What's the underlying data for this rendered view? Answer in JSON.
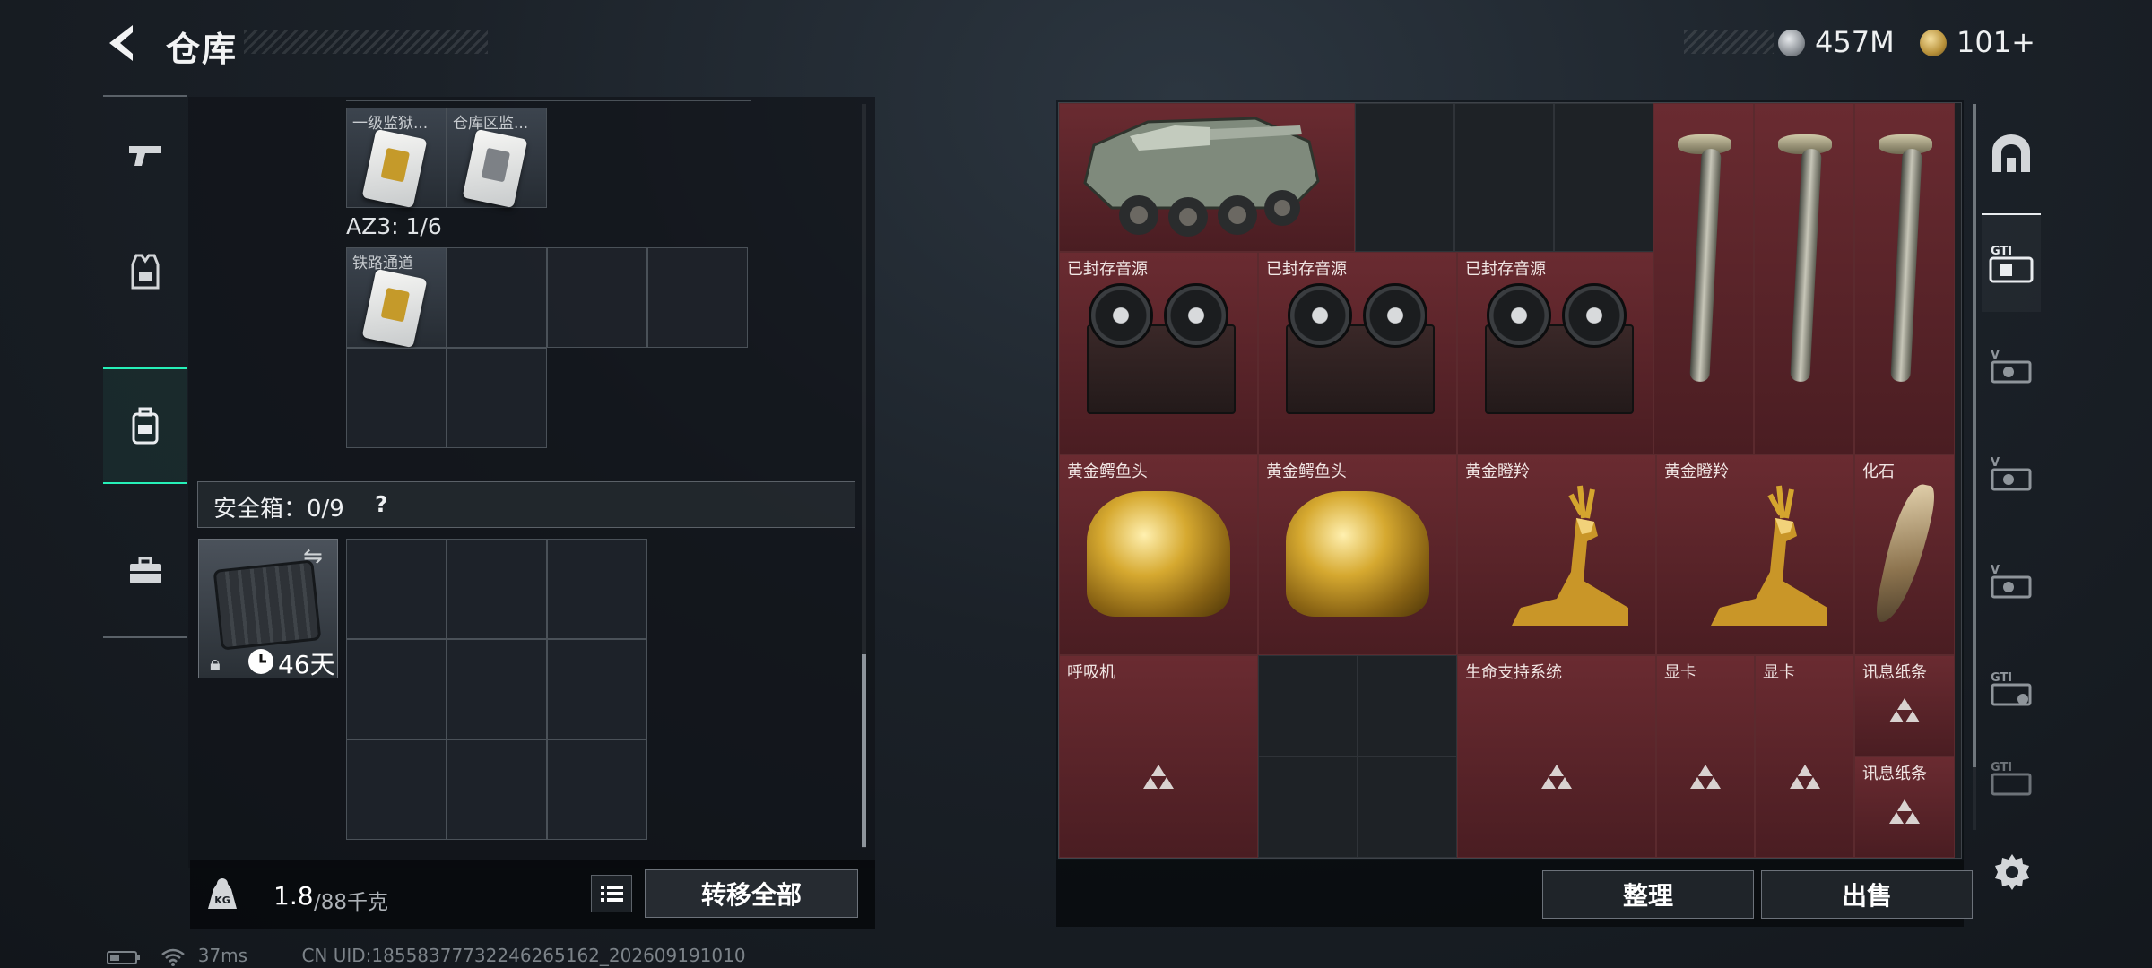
{
  "header": {
    "title": "仓库",
    "currencies": [
      {
        "icon": "silver-coin-icon",
        "value": "457M"
      },
      {
        "icon": "gold-coin-icon",
        "value": "101+"
      }
    ]
  },
  "left_tabs": [
    {
      "icon": "gun-icon",
      "active": false
    },
    {
      "icon": "armor-vest-icon",
      "active": false
    },
    {
      "icon": "backpack-icon",
      "active": true
    },
    {
      "icon": "toolbox-icon",
      "active": false
    }
  ],
  "containers": {
    "top_items": [
      "一级监狱...",
      "仓库区监..."
    ],
    "az3_label": "AZ3: 1/6",
    "az3_items": [
      "铁路通道"
    ],
    "safe_label": "安全箱：0/9",
    "safe_help": "?",
    "safe_case_days": "46天"
  },
  "footer_left": {
    "weight_current": "1.8",
    "weight_max": "/88千克",
    "transfer_all": "转移全部"
  },
  "status_bar": {
    "ping": "37ms",
    "uid": "CN UID:18558377732246265162_202609191010"
  },
  "stash_items": [
    {
      "id": "apc",
      "label": ""
    },
    {
      "id": "rec1",
      "label": "已封存音源"
    },
    {
      "id": "rec2",
      "label": "已封存音源"
    },
    {
      "id": "rec3",
      "label": "已封存音源"
    },
    {
      "id": "croc1",
      "label": "黄金鳄鱼头"
    },
    {
      "id": "croc2",
      "label": "黄金鳄鱼头"
    },
    {
      "id": "deer1",
      "label": "黄金瞪羚"
    },
    {
      "id": "deer2",
      "label": "黄金瞪羚"
    },
    {
      "id": "fossil",
      "label": "化石"
    },
    {
      "id": "resp",
      "label": "呼吸机"
    },
    {
      "id": "life",
      "label": "生命支持系统"
    },
    {
      "id": "gpu1",
      "label": "显卡"
    },
    {
      "id": "gpu2",
      "label": "显卡"
    },
    {
      "id": "note1",
      "label": "讯息纸条"
    },
    {
      "id": "note2",
      "label": "讯息纸条"
    }
  ],
  "right_tabs": [
    {
      "icon": "arch-icon"
    },
    {
      "icon": "gti-folder-icon",
      "active": true
    },
    {
      "icon": "v-box-icon"
    },
    {
      "icon": "v-box-icon"
    },
    {
      "icon": "v-box-icon"
    },
    {
      "icon": "gti-box-icon"
    },
    {
      "icon": "gti-box-icon"
    }
  ],
  "footer_right": {
    "sort": "整理",
    "sell": "出售"
  },
  "colors": {
    "accent": "#26f0b8",
    "stash_cell": "#5e262c"
  }
}
